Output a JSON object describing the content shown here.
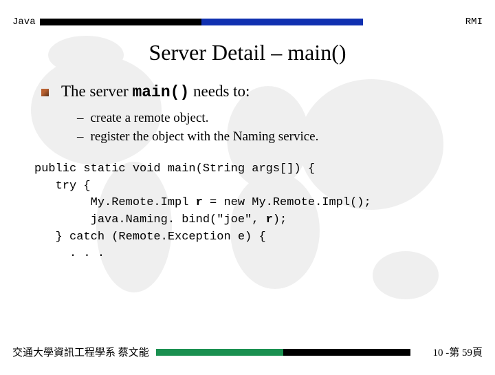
{
  "header": {
    "left": "Java",
    "right": "RMI"
  },
  "title": "Server Detail – main()",
  "bullet": {
    "pre": "The server ",
    "code": "main()",
    "post": " needs to:"
  },
  "subs": [
    "create a remote object.",
    "register the object with the Naming service."
  ],
  "code": {
    "l1": "public static void main(String args[]) {",
    "l2": "   try {",
    "l3a": "        My.Remote.Impl ",
    "l3b": "r",
    "l3c": " = new My.Remote.Impl();",
    "l4a": "        java.Naming. bind(\"joe\", ",
    "l4b": "r",
    "l4c": ");",
    "l5": "   } catch (Remote.Exception e) {",
    "l6": "     . . ."
  },
  "footer": {
    "left": "交通大學資訊工程學系 蔡文能",
    "right": "10 -第 59頁"
  }
}
